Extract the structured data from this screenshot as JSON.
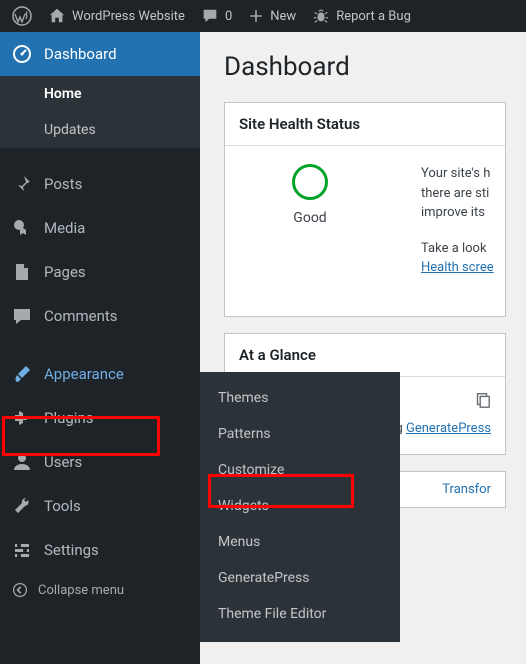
{
  "adminbar": {
    "site_name": "WordPress Website",
    "comments_count": "0",
    "new_label": "New",
    "report_label": "Report a Bug"
  },
  "sidebar": {
    "dashboard": "Dashboard",
    "submenu_home": "Home",
    "submenu_updates": "Updates",
    "posts": "Posts",
    "media": "Media",
    "pages": "Pages",
    "comments": "Comments",
    "appearance": "Appearance",
    "plugins": "Plugins",
    "users": "Users",
    "tools": "Tools",
    "settings": "Settings",
    "collapse": "Collapse menu"
  },
  "flyout": {
    "themes": "Themes",
    "patterns": "Patterns",
    "customize": "Customize",
    "widgets": "Widgets",
    "menus": "Menus",
    "generatepress": "GeneratePress",
    "theme_file_editor": "Theme File Editor"
  },
  "main": {
    "page_title": "Dashboard",
    "health": {
      "title": "Site Health Status",
      "status": "Good",
      "line1": "Your site's h",
      "line2": "there are sti",
      "line3": "improve its",
      "cta_text": "Take a look",
      "cta_link": "Health scree"
    },
    "glance": {
      "title": "At a Glance",
      "theme_prefix": "g ",
      "theme_link": "GeneratePress"
    },
    "activity_link": "Transfor"
  }
}
